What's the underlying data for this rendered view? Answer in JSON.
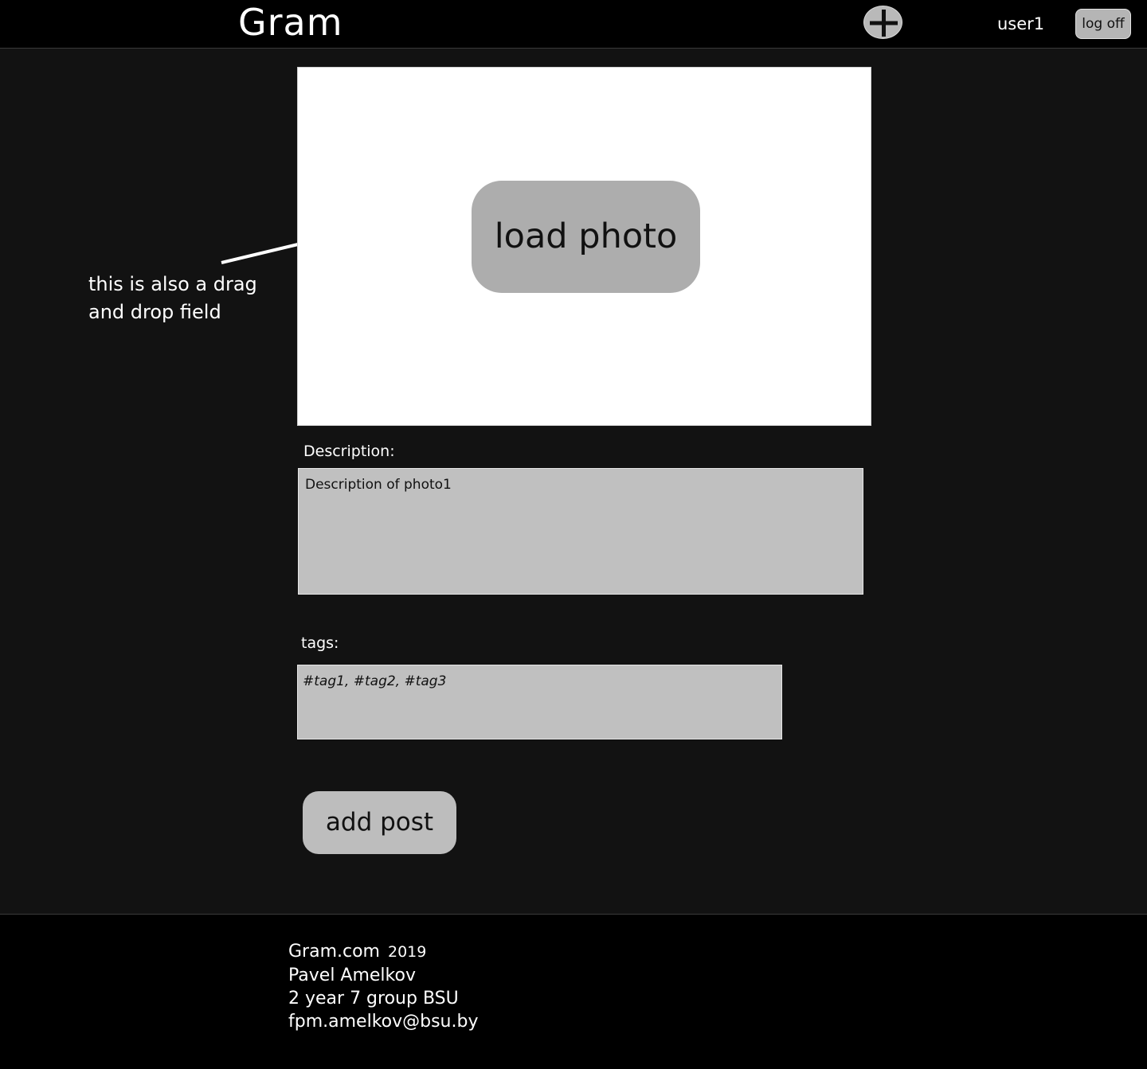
{
  "header": {
    "logo": "Gram",
    "add_icon": "plus-circle-icon",
    "username": "user1",
    "logoff_label": "log off"
  },
  "annotation": {
    "line1": "this is also a drag",
    "line2": "and drop field"
  },
  "upload": {
    "load_label": "load photo"
  },
  "description": {
    "label": "Description:",
    "value": "Description of photo1"
  },
  "tags": {
    "label": "tags:",
    "value": "#tag1, #tag2, #tag3"
  },
  "actions": {
    "add_post_label": "add post"
  },
  "footer": {
    "site": "Gram.com",
    "year": "2019",
    "author": "Pavel Amelkov",
    "group": "2 year 7 group BSU",
    "email": "fpm.amelkov@bsu.by"
  },
  "colors": {
    "page_bg": "#121212",
    "bar_bg": "#000000",
    "control_gray": "#bdbdbd"
  }
}
